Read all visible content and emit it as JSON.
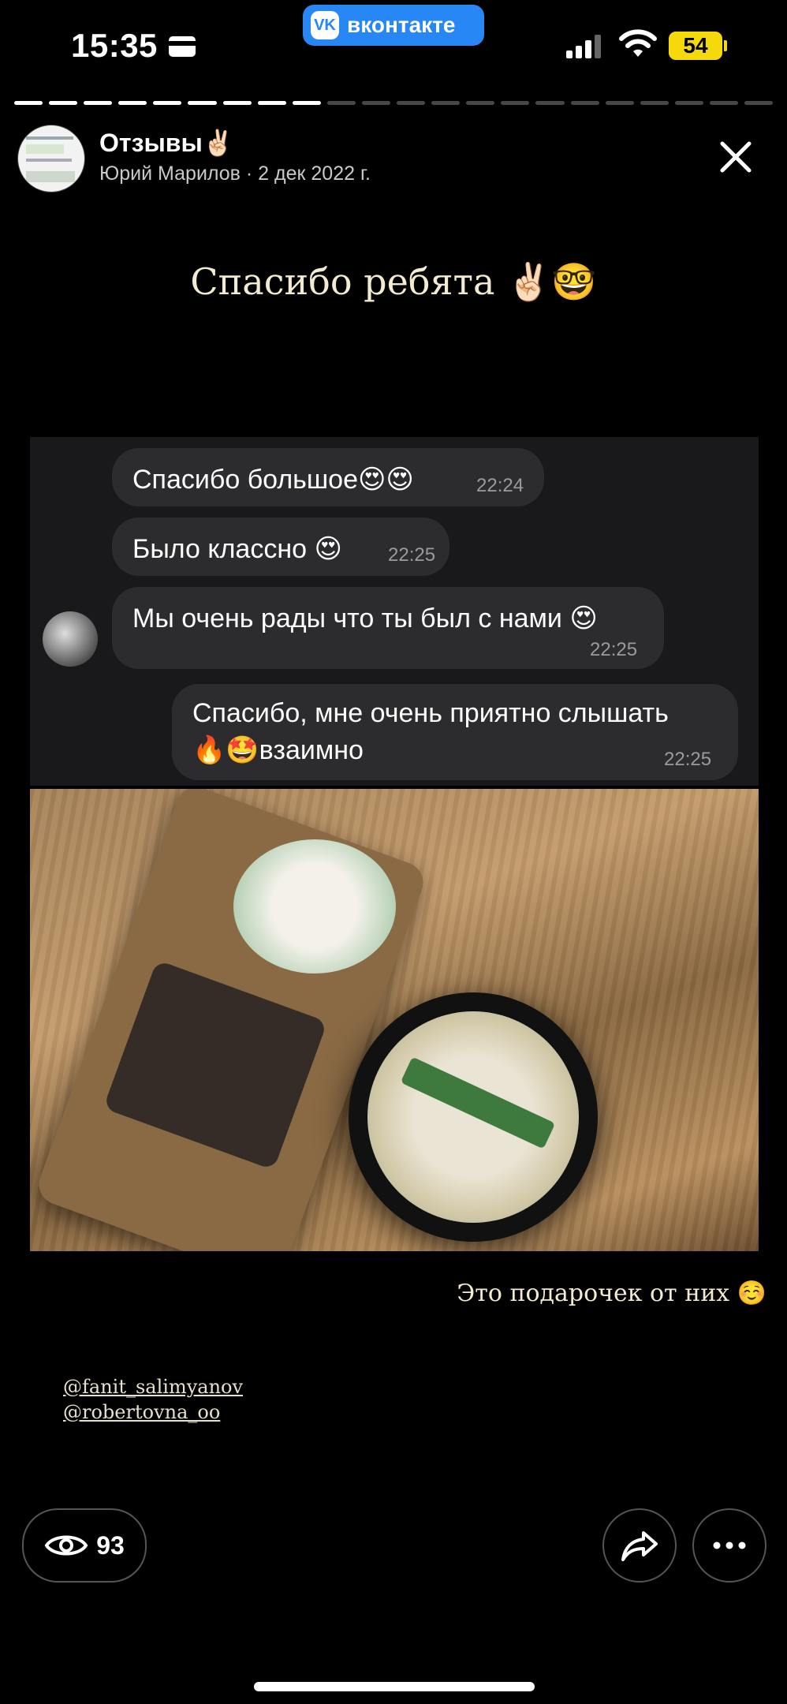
{
  "status_bar": {
    "time": "15:35",
    "app_badge": "вконтакте",
    "battery": "54"
  },
  "progress": {
    "total_segments": 22,
    "completed_segments": 9
  },
  "header": {
    "title": "Отзывы✌🏻",
    "subtitle": "Юрий Марилов · 2 дек 2022 г."
  },
  "story": {
    "heading": "Спасибо ребята ✌🏻🤓",
    "chat": [
      {
        "text": "Спасибо большое😍😍",
        "time": "22:24"
      },
      {
        "text": "Было классно 😍",
        "time": "22:25"
      },
      {
        "text": "Мы очень рады что ты был с нами 😍",
        "time": "22:25"
      },
      {
        "text_line1": "Спасибо, мне очень приятно слышать",
        "text_line2": "🔥🤩взаимно",
        "time": "22:25"
      }
    ],
    "caption": "Это подарочек от них ☺️",
    "mentions": [
      "@fanit_salimyanov",
      "@robertovna_oo"
    ]
  },
  "footer": {
    "views": "93"
  },
  "colors": {
    "background": "#000000",
    "vk_blue": "#2787f5",
    "battery_yellow": "#f5d90a",
    "bubble": "#2c2c2e"
  }
}
